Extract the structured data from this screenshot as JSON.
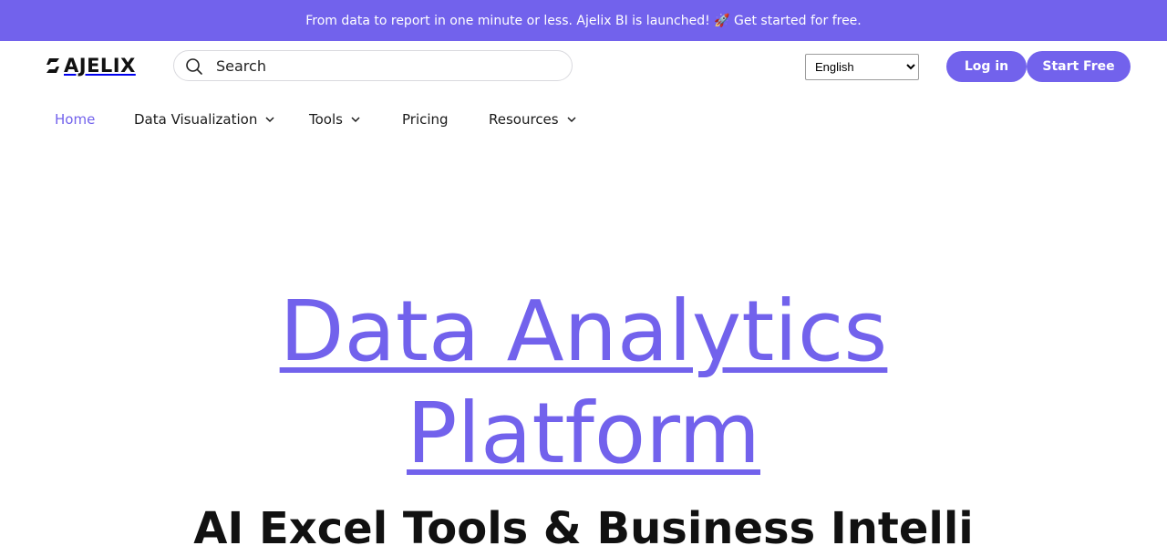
{
  "banner": {
    "text": "From data to report in one minute or less. Ajelix BI is launched! 🚀 Get started for free."
  },
  "header": {
    "logo_text": "AJELIX",
    "search": {
      "placeholder": "Search",
      "icon": "search-icon"
    },
    "language": {
      "selected": "English",
      "options": [
        "English"
      ]
    },
    "login_label": "Log in",
    "start_label": "Start Free"
  },
  "nav": {
    "items": [
      {
        "label": "Home",
        "active": true,
        "dropdown": false
      },
      {
        "label": "Data Visualization",
        "active": false,
        "dropdown": true
      },
      {
        "label": "Tools",
        "active": false,
        "dropdown": true
      },
      {
        "label": "Pricing",
        "active": false,
        "dropdown": false
      },
      {
        "label": "Resources",
        "active": false,
        "dropdown": true
      }
    ]
  },
  "hero": {
    "title_line1": "Data Analytics",
    "title_line2": "Platform",
    "subtitle": "AI Excel Tools & Business Intelli"
  },
  "colors": {
    "accent": "#7262ec",
    "text": "#1a1a1a",
    "background": "#ffffff"
  }
}
